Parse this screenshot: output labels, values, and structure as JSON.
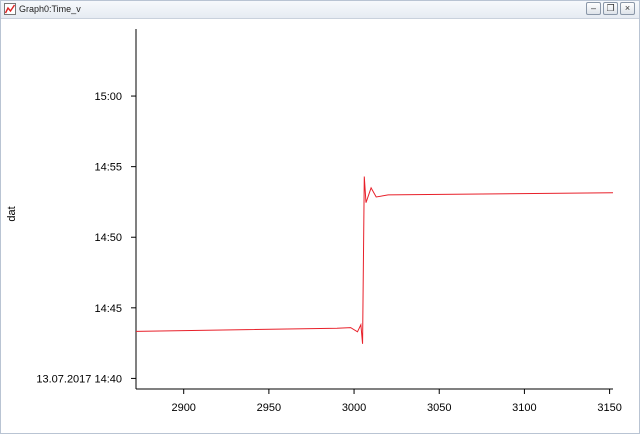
{
  "window": {
    "title": "Graph0:Time_v",
    "buttons": {
      "minimize_icon": "minimize-icon",
      "restore_icon": "restore-icon",
      "close_icon": "close-icon"
    }
  },
  "chart_data": {
    "type": "line",
    "title": "",
    "xlabel": "",
    "ylabel": "dat",
    "xlim": [
      2872,
      3152
    ],
    "ylim": [
      "13.07.2017 14:39:15",
      "13.07.2017 15:04:45"
    ],
    "x_ticks": [
      2900,
      2950,
      3000,
      3050,
      3100,
      3150
    ],
    "y_ticks": [
      {
        "value": "13.07.2017 14:40",
        "label": "13.07.2017 14:40"
      },
      {
        "value": "13.07.2017 14:45",
        "label": "14:45"
      },
      {
        "value": "13.07.2017 14:50",
        "label": "14:50"
      },
      {
        "value": "13.07.2017 14:55",
        "label": "14:55"
      },
      {
        "value": "13.07.2017 15:00",
        "label": "15:00"
      }
    ],
    "grid": false,
    "series": [
      {
        "color": "#e8202a",
        "points": [
          {
            "x": 2872,
            "y": "13.07.2017 14:43:20"
          },
          {
            "x": 2990,
            "y": "13.07.2017 14:43:33"
          },
          {
            "x": 2998,
            "y": "13.07.2017 14:43:36"
          },
          {
            "x": 3002,
            "y": "13.07.2017 14:43:18"
          },
          {
            "x": 3004,
            "y": "13.07.2017 14:43:48"
          },
          {
            "x": 3005,
            "y": "13.07.2017 14:42:27"
          },
          {
            "x": 3006,
            "y": "13.07.2017 14:54:18"
          },
          {
            "x": 3007,
            "y": "13.07.2017 14:52:27"
          },
          {
            "x": 3010,
            "y": "13.07.2017 14:53:30"
          },
          {
            "x": 3013,
            "y": "13.07.2017 14:52:51"
          },
          {
            "x": 3020,
            "y": "13.07.2017 14:53:00"
          },
          {
            "x": 3152,
            "y": "13.07.2017 14:53:09"
          }
        ]
      }
    ]
  }
}
